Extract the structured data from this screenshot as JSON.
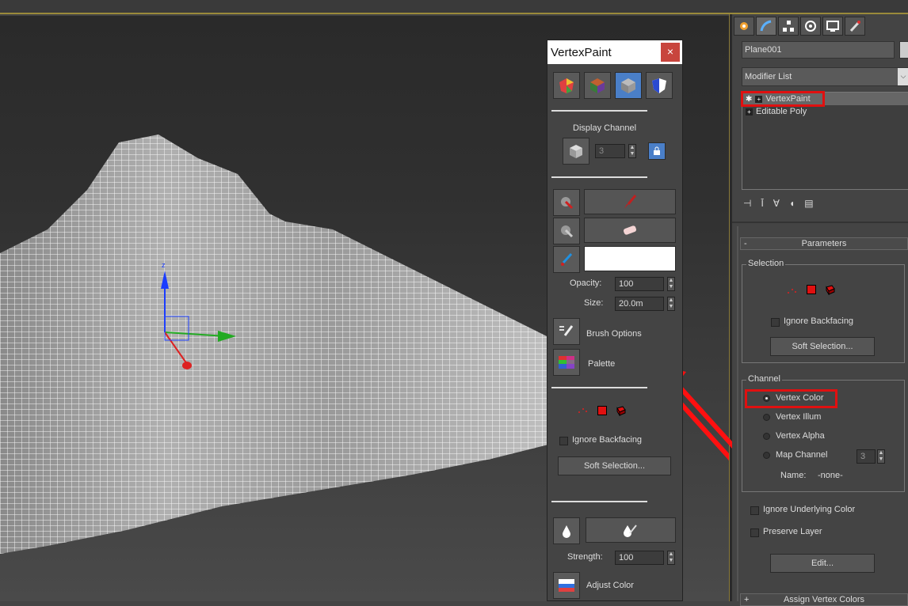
{
  "vertexpaint": {
    "title": "VertexPaint",
    "close": "×",
    "display_channel_label": "Display Channel",
    "display_channel_value": "3",
    "opacity_label": "Opacity:",
    "opacity_value": "100",
    "size_label": "Size:",
    "size_value": "20.0m",
    "brush_options_label": "Brush Options",
    "palette_label": "Palette",
    "ignore_backfacing_label": "Ignore Backfacing",
    "soft_selection_label": "Soft Selection...",
    "strength_label": "Strength:",
    "strength_value": "100",
    "adjust_color_label": "Adjust Color",
    "paint_color": "#ffffff"
  },
  "command_panel": {
    "object_name": "Plane001",
    "modifier_list_label": "Modifier List",
    "modifier_stack": [
      {
        "label": "VertexPaint",
        "selected": true
      },
      {
        "label": "Editable Poly",
        "selected": false
      }
    ],
    "parameters_title": "Parameters",
    "parameters_collapse": "-",
    "selection_group": "Selection",
    "ignore_backfacing_label": "Ignore Backfacing",
    "soft_selection_label": "Soft Selection...",
    "channel_group": "Channel",
    "channel_options": [
      "Vertex Color",
      "Vertex Illum",
      "Vertex Alpha",
      "Map Channel"
    ],
    "channel_selected": "Vertex Color",
    "map_channel_value": "3",
    "name_label": "Name:",
    "name_value": "-none-",
    "ignore_underlying_label": "Ignore Underlying Color",
    "preserve_layer_label": "Preserve Layer",
    "edit_label": "Edit...",
    "assign_rollout_title": "Assign Vertex Colors",
    "assign_rollout_expand": "+"
  },
  "colors": {
    "highlight": "#e01010",
    "accent_blue": "#4a7fc8",
    "panel_bg": "#444444"
  }
}
